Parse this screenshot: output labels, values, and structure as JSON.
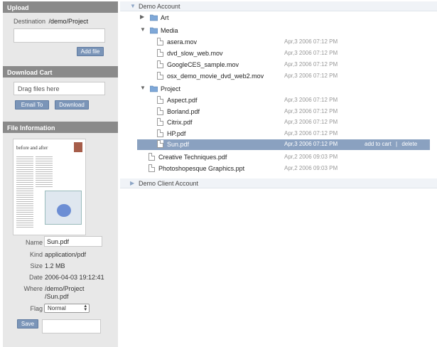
{
  "upload": {
    "header": "Upload",
    "destination_label": "Destination",
    "destination_path": "/demo/Project",
    "input_value": "",
    "add_file_label": "Add file"
  },
  "cart": {
    "header": "Download Cart",
    "drag_text": "Drag files here",
    "email_label": "Email To",
    "download_label": "Download"
  },
  "info": {
    "header": "File Information",
    "thumbnail_title": "before and after",
    "name_label": "Name",
    "name_value": "Sun.pdf",
    "kind_label": "Kind",
    "kind_value": "application/pdf",
    "size_label": "Size",
    "size_value": "1.2 MB",
    "date_label": "Date",
    "date_value": "2006-04-03 19:12:41",
    "where_label": "Where",
    "where_line1": "/demo/Project",
    "where_line2": "/Sun.pdf",
    "flag_label": "Flag",
    "flag_value": "Normal",
    "save_label": "Save",
    "comment_value": ""
  },
  "tree": {
    "root1": "Demo Account",
    "root2": "Demo Client Account",
    "art": "Art",
    "media": "Media",
    "project": "Project",
    "media_files": [
      {
        "name": "asera.mov",
        "date": "Apr,3 2006 07:12 PM"
      },
      {
        "name": "dvd_slow_web.mov",
        "date": "Apr,3 2006 07:12 PM"
      },
      {
        "name": "GoogleCES_sample.mov",
        "date": "Apr,3 2006 07:12 PM"
      },
      {
        "name": "osx_demo_movie_dvd_web2.mov",
        "date": "Apr,3 2006 07:12 PM"
      }
    ],
    "project_files": [
      {
        "name": "Aspect.pdf",
        "date": "Apr,3 2006 07:12 PM"
      },
      {
        "name": "Borland.pdf",
        "date": "Apr,3 2006 07:12 PM"
      },
      {
        "name": "Citrix.pdf",
        "date": "Apr,3 2006 07:12 PM"
      },
      {
        "name": "HP.pdf",
        "date": "Apr,3 2006 07:12 PM"
      },
      {
        "name": "Sun.pdf",
        "date": "Apr,3 2006 07:12 PM"
      }
    ],
    "root_files": [
      {
        "name": "Creative Techniques.pdf",
        "date": "Apr,2 2006 09:03 PM"
      },
      {
        "name": "Photoshopesque Graphics.ppt",
        "date": "Apr,2 2006 09:03 PM"
      }
    ],
    "add_to_cart": "add to cart",
    "separator": "|",
    "delete": "delete"
  },
  "colors": {
    "panel_header": "#8a8a8a",
    "button": "#7b95b8",
    "selected_row": "#8aa1c0",
    "folder_blue": "#7fa8d8"
  }
}
